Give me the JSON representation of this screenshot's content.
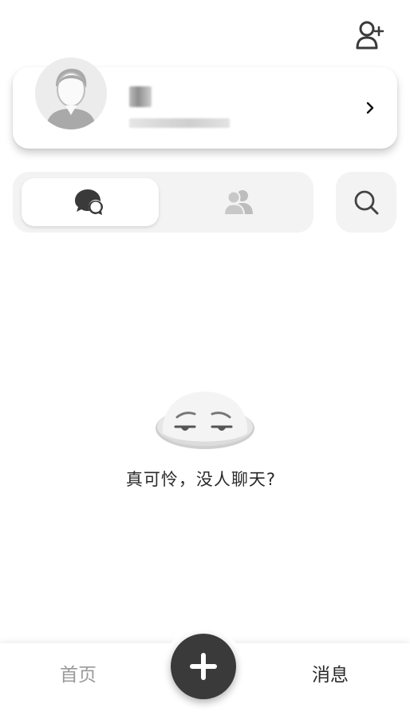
{
  "header": {
    "add_friend_icon": "person-plus-icon"
  },
  "profile": {
    "avatar_icon": "default-avatar-icon",
    "name": "",
    "subtitle": "",
    "chevron_icon": "chevron-right-icon"
  },
  "tabs": [
    {
      "id": "chats",
      "icon": "chat-bubbles-icon",
      "active": true
    },
    {
      "id": "contacts",
      "icon": "people-icon",
      "active": false
    }
  ],
  "search": {
    "icon": "search-icon"
  },
  "empty_state": {
    "icon": "sad-face-icon",
    "text": "真可怜，没人聊天?"
  },
  "bottom_nav": {
    "home_label": "首页",
    "messages_label": "消息",
    "add_icon": "plus-icon",
    "active": "messages"
  },
  "colors": {
    "fab": "#3a3a3a",
    "inactive_text": "#9a9a9a",
    "active_text": "#2b2b2b",
    "tab_bg": "#f3f3f3"
  }
}
